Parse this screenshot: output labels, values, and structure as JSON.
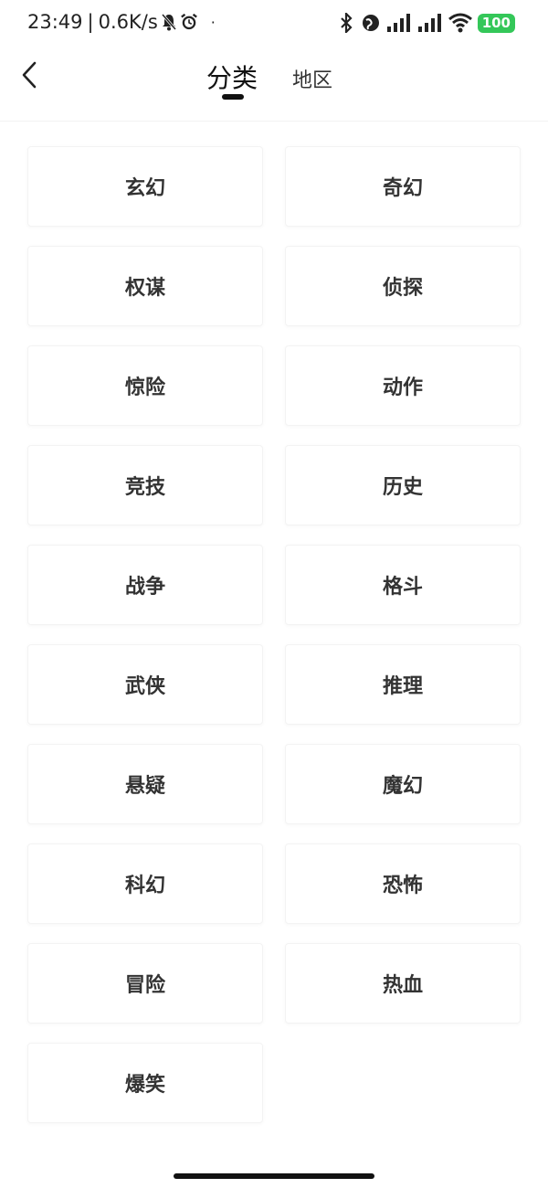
{
  "status": {
    "time": "23:49",
    "separator": "|",
    "speed": "0.6K/s",
    "battery": "100",
    "dot": "·"
  },
  "header": {
    "tabs": [
      {
        "label": "分类",
        "active": true
      },
      {
        "label": "地区",
        "active": false
      }
    ]
  },
  "categories": [
    "玄幻",
    "奇幻",
    "权谋",
    "侦探",
    "惊险",
    "动作",
    "竞技",
    "历史",
    "战争",
    "格斗",
    "武侠",
    "推理",
    "悬疑",
    "魔幻",
    "科幻",
    "恐怖",
    "冒险",
    "热血",
    "爆笑"
  ],
  "colors": {
    "accent": "#111111",
    "battery": "#34c759",
    "text": "#333333"
  }
}
